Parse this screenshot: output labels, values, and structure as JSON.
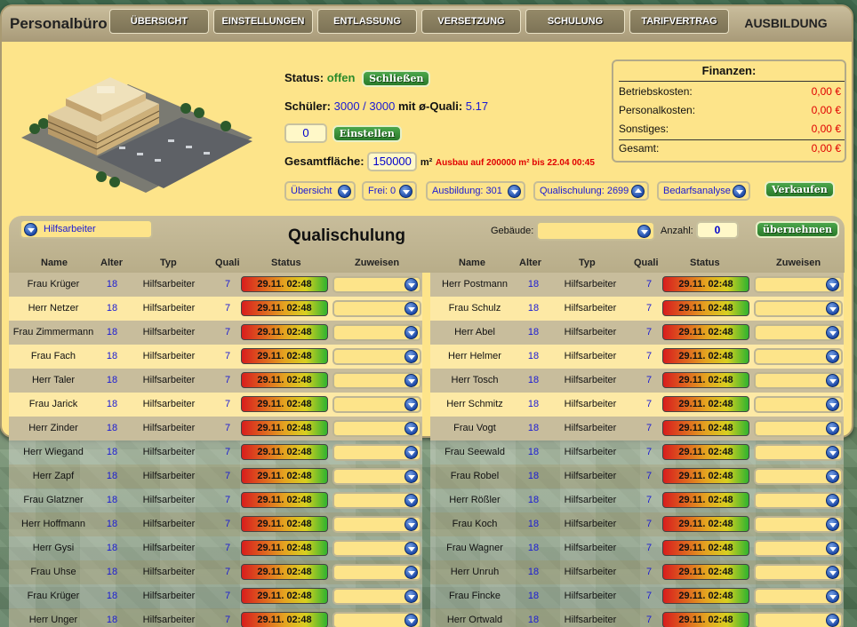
{
  "app_title": "Personalbüro",
  "tabs": [
    {
      "label": "ÜBERSICHT"
    },
    {
      "label": "EINSTELLUNGEN"
    },
    {
      "label": "ENTLASSUNG"
    },
    {
      "label": "VERSETZUNG"
    },
    {
      "label": "SCHULUNG"
    },
    {
      "label": "TARIFVERTRAG"
    },
    {
      "label": "AUSBILDUNG"
    }
  ],
  "status": {
    "label": "Status:",
    "value": "offen",
    "close_button": "Schließen",
    "students_label": "Schüler:",
    "students_value": "3000 / 3000",
    "quali_label": "mit ø-Quali:",
    "quali_value": "5.17",
    "hire_input": "0",
    "hire_button": "Einstellen",
    "area_label": "Gesamtfläche:",
    "area_value": "150000",
    "area_unit": "m²",
    "expansion_notice": "Ausbau auf 200000 m² bis 22.04 00:45"
  },
  "finance": {
    "title": "Finanzen:",
    "rows": [
      {
        "label": "Betriebskosten:",
        "value": "0,00 €"
      },
      {
        "label": "Personalkosten:",
        "value": "0,00 €"
      },
      {
        "label": "Sonstiges:",
        "value": "0,00 €"
      },
      {
        "label": "Gesamt:",
        "value": "0,00 €"
      }
    ]
  },
  "filters": {
    "overview": "Übersicht",
    "free": "Frei: 0",
    "training": "Ausbildung: 301",
    "qualification": "Qualischulung: 2699",
    "needs": "Bedarfsanalyse",
    "sell_button": "Verkaufen"
  },
  "panel": {
    "job_select": "Hilfsarbeiter",
    "title": "Qualischulung",
    "building_label": "Gebäude:",
    "building_value": "",
    "count_label": "Anzahl:",
    "count_value": "0",
    "apply_button": "übernehmen",
    "columns": [
      "Name",
      "Alter",
      "Typ",
      "Quali",
      "Status",
      "Zuweisen"
    ]
  },
  "left_rows": [
    {
      "name": "Frau Krüger",
      "age": "18",
      "type": "Hilfsarbeiter",
      "quali": "7",
      "status": "29.11. 02:48"
    },
    {
      "name": "Herr Netzer",
      "age": "18",
      "type": "Hilfsarbeiter",
      "quali": "7",
      "status": "29.11. 02:48"
    },
    {
      "name": "Frau Zimmermann",
      "age": "18",
      "type": "Hilfsarbeiter",
      "quali": "7",
      "status": "29.11. 02:48"
    },
    {
      "name": "Frau Fach",
      "age": "18",
      "type": "Hilfsarbeiter",
      "quali": "7",
      "status": "29.11. 02:48"
    },
    {
      "name": "Herr Taler",
      "age": "18",
      "type": "Hilfsarbeiter",
      "quali": "7",
      "status": "29.11. 02:48"
    },
    {
      "name": "Frau Jarick",
      "age": "18",
      "type": "Hilfsarbeiter",
      "quali": "7",
      "status": "29.11. 02:48"
    },
    {
      "name": "Herr Zinder",
      "age": "18",
      "type": "Hilfsarbeiter",
      "quali": "7",
      "status": "29.11. 02:48"
    },
    {
      "name": "Herr Wiegand",
      "age": "18",
      "type": "Hilfsarbeiter",
      "quali": "7",
      "status": "29.11. 02:48"
    },
    {
      "name": "Herr Zapf",
      "age": "18",
      "type": "Hilfsarbeiter",
      "quali": "7",
      "status": "29.11. 02:48"
    },
    {
      "name": "Frau Glatzner",
      "age": "18",
      "type": "Hilfsarbeiter",
      "quali": "7",
      "status": "29.11. 02:48"
    },
    {
      "name": "Herr Hoffmann",
      "age": "18",
      "type": "Hilfsarbeiter",
      "quali": "7",
      "status": "29.11. 02:48"
    },
    {
      "name": "Herr Gysi",
      "age": "18",
      "type": "Hilfsarbeiter",
      "quali": "7",
      "status": "29.11. 02:48"
    },
    {
      "name": "Frau Uhse",
      "age": "18",
      "type": "Hilfsarbeiter",
      "quali": "7",
      "status": "29.11. 02:48"
    },
    {
      "name": "Frau Krüger",
      "age": "18",
      "type": "Hilfsarbeiter",
      "quali": "7",
      "status": "29.11. 02:48"
    },
    {
      "name": "Herr Unger",
      "age": "18",
      "type": "Hilfsarbeiter",
      "quali": "7",
      "status": "29.11. 02:48"
    }
  ],
  "right_rows": [
    {
      "name": "Herr Postmann",
      "age": "18",
      "type": "Hilfsarbeiter",
      "quali": "7",
      "status": "29.11. 02:48"
    },
    {
      "name": "Frau Schulz",
      "age": "18",
      "type": "Hilfsarbeiter",
      "quali": "7",
      "status": "29.11. 02:48"
    },
    {
      "name": "Herr Abel",
      "age": "18",
      "type": "Hilfsarbeiter",
      "quali": "7",
      "status": "29.11. 02:48"
    },
    {
      "name": "Herr Helmer",
      "age": "18",
      "type": "Hilfsarbeiter",
      "quali": "7",
      "status": "29.11. 02:48"
    },
    {
      "name": "Herr Tosch",
      "age": "18",
      "type": "Hilfsarbeiter",
      "quali": "7",
      "status": "29.11. 02:48"
    },
    {
      "name": "Herr Schmitz",
      "age": "18",
      "type": "Hilfsarbeiter",
      "quali": "7",
      "status": "29.11. 02:48"
    },
    {
      "name": "Frau Vogt",
      "age": "18",
      "type": "Hilfsarbeiter",
      "quali": "7",
      "status": "29.11. 02:48"
    },
    {
      "name": "Frau Seewald",
      "age": "18",
      "type": "Hilfsarbeiter",
      "quali": "7",
      "status": "29.11. 02:48"
    },
    {
      "name": "Frau Robel",
      "age": "18",
      "type": "Hilfsarbeiter",
      "quali": "7",
      "status": "29.11. 02:48"
    },
    {
      "name": "Herr Rößler",
      "age": "18",
      "type": "Hilfsarbeiter",
      "quali": "7",
      "status": "29.11. 02:48"
    },
    {
      "name": "Frau Koch",
      "age": "18",
      "type": "Hilfsarbeiter",
      "quali": "7",
      "status": "29.11. 02:48"
    },
    {
      "name": "Frau Wagner",
      "age": "18",
      "type": "Hilfsarbeiter",
      "quali": "7",
      "status": "29.11. 02:48"
    },
    {
      "name": "Herr Unruh",
      "age": "18",
      "type": "Hilfsarbeiter",
      "quali": "7",
      "status": "29.11. 02:48"
    },
    {
      "name": "Frau Fincke",
      "age": "18",
      "type": "Hilfsarbeiter",
      "quali": "7",
      "status": "29.11. 02:48"
    },
    {
      "name": "Herr Ortwald",
      "age": "18",
      "type": "Hilfsarbeiter",
      "quali": "7",
      "status": "29.11. 02:48"
    }
  ],
  "colors": {
    "panel_bg": "#fde48a",
    "header_bg": "#b8ad89",
    "tab_bg": "#7d7356",
    "value_blue": "#1a1ad4",
    "status_green": "#2a8a2a",
    "cost_red": "#e00000"
  }
}
